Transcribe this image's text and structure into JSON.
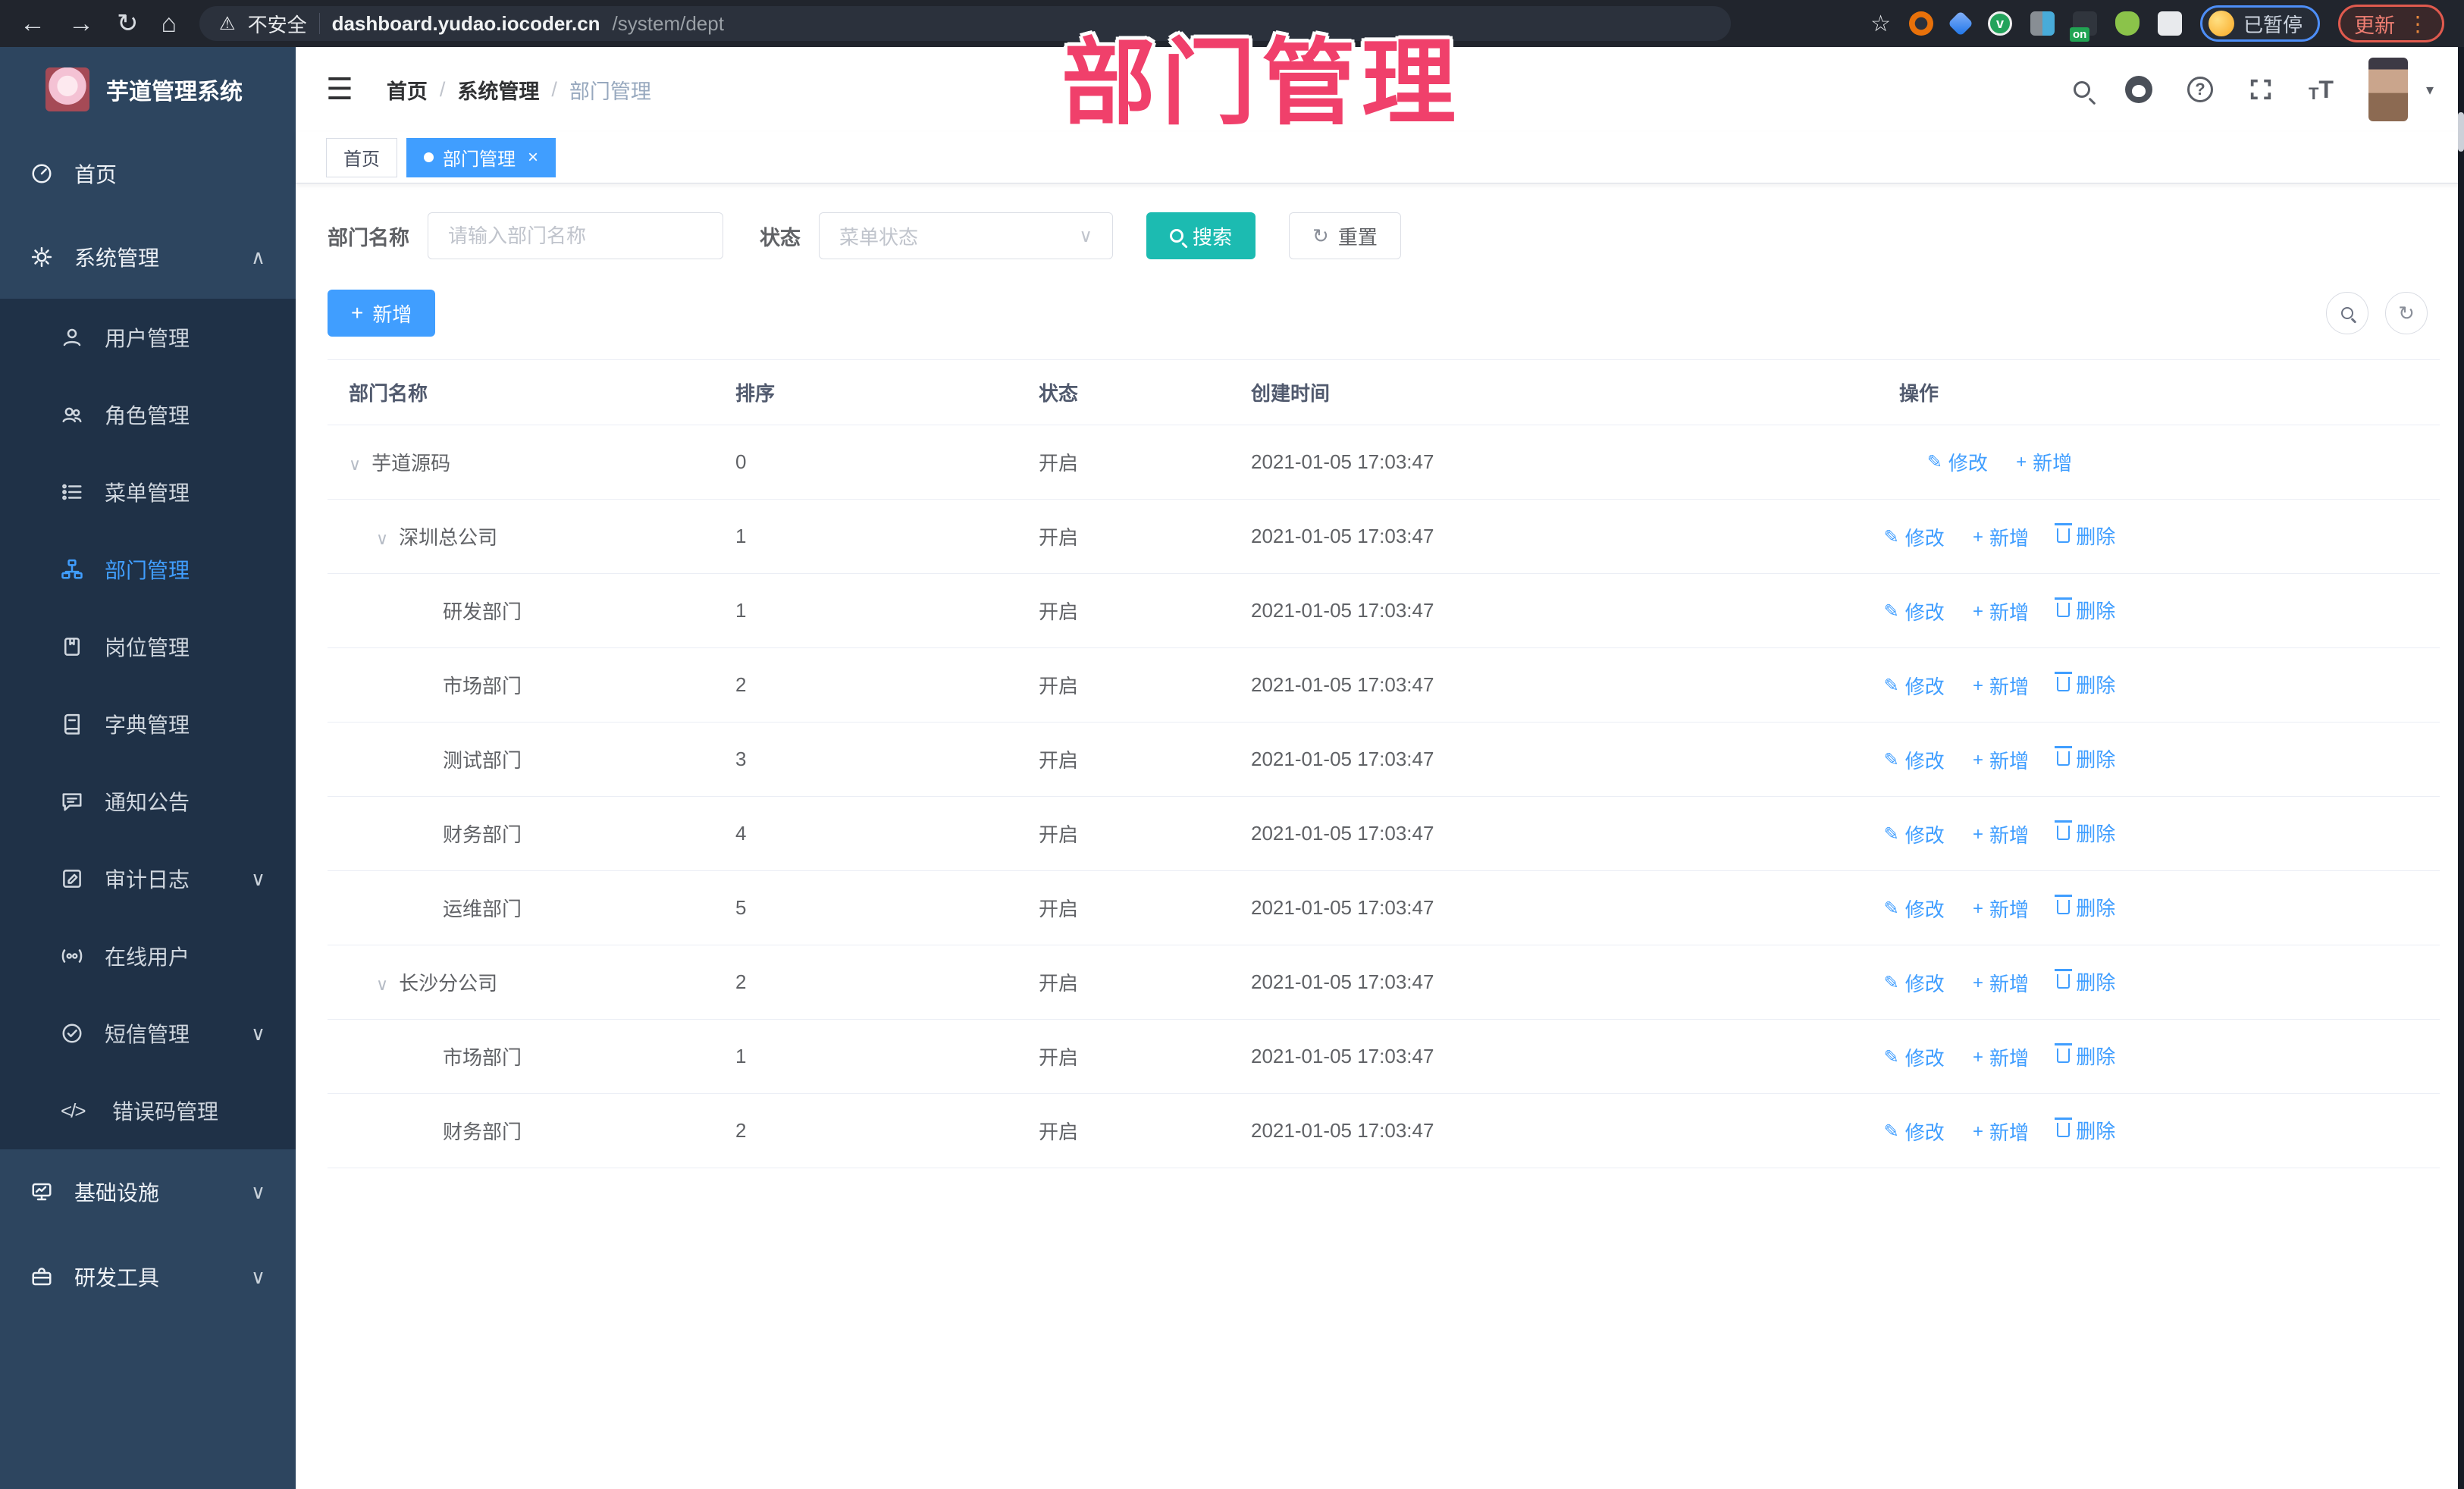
{
  "browser": {
    "security_label": "不安全",
    "url_host": "dashboard.yudao.iocoder.cn",
    "url_path": "/system/dept",
    "paused_label": "已暂停",
    "update_label": "更新",
    "ext_on_badge": "on"
  },
  "overlay": {
    "title": "部门管理"
  },
  "icons": {
    "back": "←",
    "forward": "→",
    "reload": "↻",
    "home": "⌂",
    "warning": "⚠",
    "star": "☆",
    "menu_dots": "⋮",
    "hamburger": "☰",
    "help": "?",
    "caret_down": "▾",
    "tree_caret": "∨",
    "chev_down": "∨",
    "chev_up": "∧",
    "select_arrow": "∨",
    "plus": "+",
    "edit": "✎",
    "refresh": "↻",
    "close": "×",
    "code": "</>",
    "font_big": "T",
    "font_small": "T"
  },
  "colors": {
    "primary": "#409eff",
    "search_teal": "#1cbbb1",
    "annotation_pink": "#f0406b",
    "sidebar_bg": "#2d455f",
    "submenu_bg": "#1f3147"
  },
  "sidebar": {
    "logo_title": "芋道管理系统",
    "items": [
      {
        "label": "首页"
      },
      {
        "label": "系统管理"
      }
    ],
    "submenu": [
      {
        "label": "用户管理"
      },
      {
        "label": "角色管理"
      },
      {
        "label": "菜单管理"
      },
      {
        "label": "部门管理",
        "active": true
      },
      {
        "label": "岗位管理"
      },
      {
        "label": "字典管理"
      },
      {
        "label": "通知公告"
      },
      {
        "label": "审计日志"
      },
      {
        "label": "在线用户"
      },
      {
        "label": "短信管理"
      },
      {
        "label": "错误码管理"
      }
    ],
    "tail": [
      {
        "label": "基础设施"
      },
      {
        "label": "研发工具"
      }
    ]
  },
  "breadcrumb": {
    "items": [
      "首页",
      "系统管理",
      "部门管理"
    ],
    "sep": "/"
  },
  "tabs": {
    "home": "首页",
    "active": "部门管理"
  },
  "filter": {
    "name_label": "部门名称",
    "name_placeholder": "请输入部门名称",
    "status_label": "状态",
    "status_placeholder": "菜单状态",
    "search_label": "搜索",
    "reset_label": "重置"
  },
  "toolbar": {
    "add_label": "新增"
  },
  "table": {
    "headers": [
      "部门名称",
      "排序",
      "状态",
      "创建时间",
      "操作"
    ],
    "actions": {
      "edit": "修改",
      "add": "新增",
      "del": "删除"
    },
    "rows": [
      {
        "name": "芋道源码",
        "sort": "0",
        "status": "开启",
        "time": "2021-01-05 17:03:47"
      },
      {
        "name": "深圳总公司",
        "sort": "1",
        "status": "开启",
        "time": "2021-01-05 17:03:47"
      },
      {
        "name": "研发部门",
        "sort": "1",
        "status": "开启",
        "time": "2021-01-05 17:03:47"
      },
      {
        "name": "市场部门",
        "sort": "2",
        "status": "开启",
        "time": "2021-01-05 17:03:47"
      },
      {
        "name": "测试部门",
        "sort": "3",
        "status": "开启",
        "time": "2021-01-05 17:03:47"
      },
      {
        "name": "财务部门",
        "sort": "4",
        "status": "开启",
        "time": "2021-01-05 17:03:47"
      },
      {
        "name": "运维部门",
        "sort": "5",
        "status": "开启",
        "time": "2021-01-05 17:03:47"
      },
      {
        "name": "长沙分公司",
        "sort": "2",
        "status": "开启",
        "time": "2021-01-05 17:03:47"
      },
      {
        "name": "市场部门",
        "sort": "1",
        "status": "开启",
        "time": "2021-01-05 17:03:47"
      },
      {
        "name": "财务部门",
        "sort": "2",
        "status": "开启",
        "time": "2021-01-05 17:03:47"
      }
    ]
  }
}
